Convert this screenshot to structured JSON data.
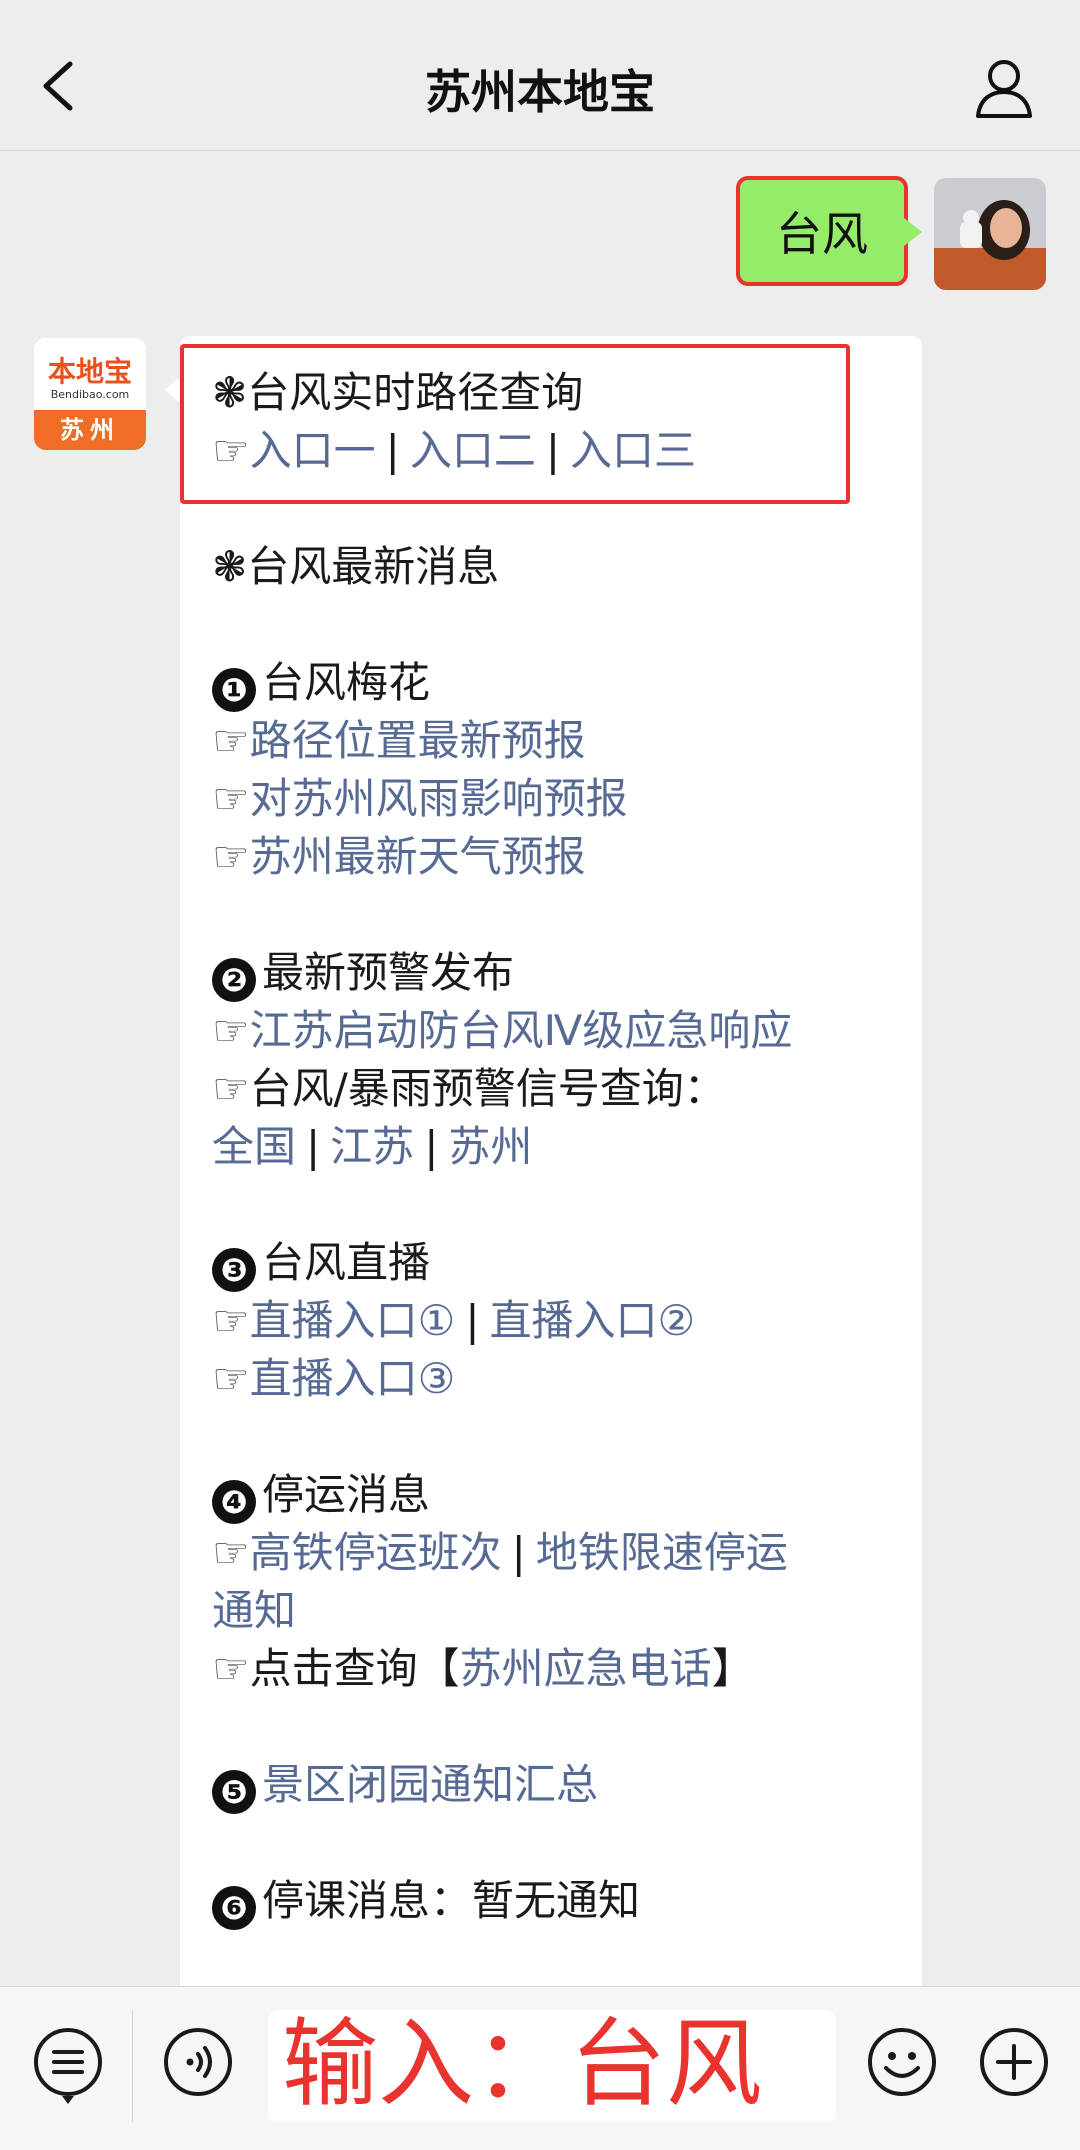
{
  "header": {
    "title": "苏州本地宝"
  },
  "user_message": {
    "text": "台风"
  },
  "bot": {
    "avatar": {
      "logo_text": "本地宝",
      "logo_sub": "Bendibao.com",
      "city": "苏州"
    },
    "query_title": "❃台风实时路径查询",
    "query_links": [
      "入口一",
      "入口二",
      "入口三"
    ],
    "news_title": "❃台风最新消息",
    "sections": {
      "s1": {
        "num": "❶",
        "title": "台风梅花",
        "links": [
          "路径位置最新预报",
          "对苏州风雨影响预报",
          "苏州最新天气预报"
        ]
      },
      "s2": {
        "num": "❷",
        "title": "最新预警发布",
        "link1": "江苏启动防台风Ⅳ级应急响应",
        "text": "台风/暴雨预警信号查询：",
        "links": [
          "全国",
          "江苏",
          "苏州"
        ]
      },
      "s3": {
        "num": "❸",
        "title": "台风直播",
        "links": [
          "直播入口①",
          "直播入口②",
          "直播入口③"
        ]
      },
      "s4": {
        "num": "❹",
        "title": "停运消息",
        "links": [
          "高铁停运班次",
          "地铁限速停运",
          "通知"
        ],
        "text_prefix": "点击查询【",
        "link_call": "苏州应急电话",
        "text_suffix": "】"
      },
      "s5": {
        "num": "❺",
        "link": "景区闭园通知汇总"
      },
      "s6": {
        "num": "❻",
        "text": "停课消息：暂无通知"
      }
    },
    "hand": "☞",
    "separator": "|"
  },
  "input": {
    "text": "输入：台风"
  },
  "colors": {
    "link": "#566a94",
    "highlight": "#e8332e",
    "bubble_user": "#95ec69"
  }
}
